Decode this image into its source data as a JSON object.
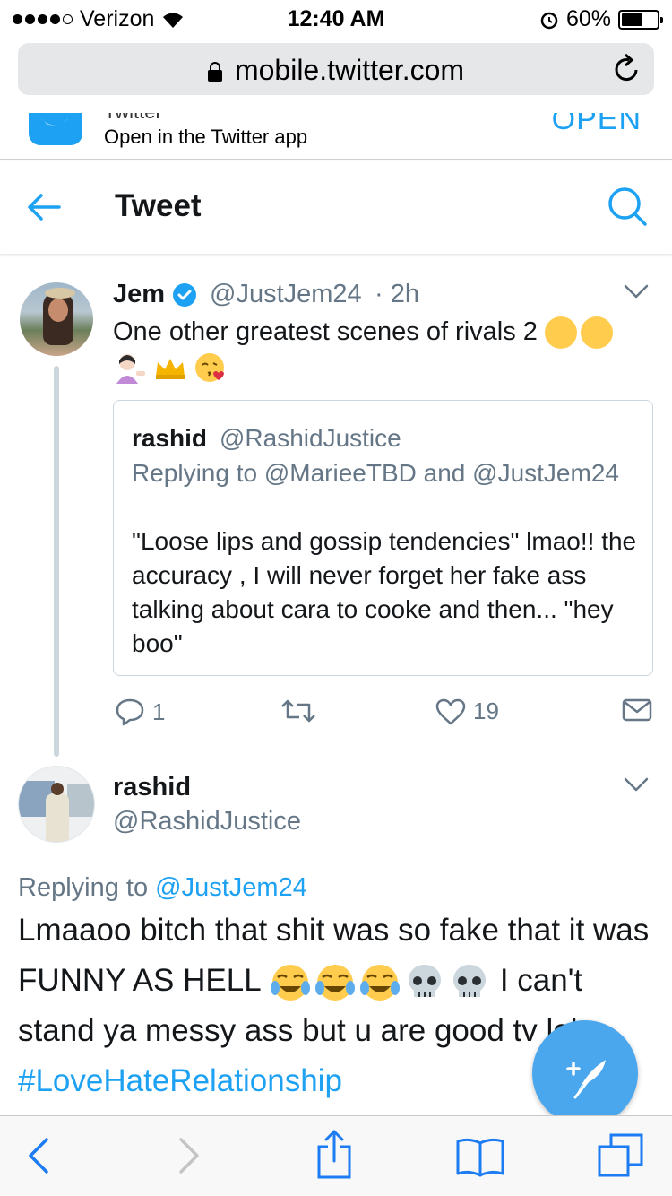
{
  "status_bar": {
    "carrier": "Verizon",
    "time": "12:40 AM",
    "battery_percent": "60%",
    "battery_level": 0.6
  },
  "browser": {
    "url": "mobile.twitter.com"
  },
  "app_banner": {
    "app_name": "Twitter",
    "subtitle": "Open in the Twitter app",
    "open_label": "OPEN"
  },
  "header": {
    "title": "Tweet"
  },
  "tweet1": {
    "name": "Jem",
    "handle": "@JustJem24",
    "time": "· 2h",
    "text": "One other greatest scenes of rivals 2",
    "quoted": {
      "name": "rashid",
      "handle": "@RashidJustice",
      "replying_to": "Replying to @MarieeTBD and @JustJem24",
      "text": "\"Loose lips and gossip tendencies\" lmao!! the accuracy , I will never forget her fake ass talking about cara to cooke and then... \"hey boo\""
    },
    "reply_count": "1",
    "like_count": "19"
  },
  "tweet2": {
    "name": "rashid",
    "handle": "@RashidJustice",
    "replying_label": "Replying to",
    "replying_handle": "@JustJem24",
    "text_part1": "Lmaaoo bitch that shit was so fake that it was FUNNY AS HELL",
    "text_part2": "I can't stand ya messy ass but u are good tv lol",
    "hashtag": "#LoveHateRelationship"
  },
  "colors": {
    "brand_blue": "#1da1f2",
    "text_primary": "#14171a",
    "text_secondary": "#657786"
  },
  "icons": [
    "back-arrow-icon",
    "search-icon",
    "verified-icon",
    "chevron-down-icon",
    "reply-icon",
    "retweet-icon",
    "like-icon",
    "message-icon",
    "compose-icon",
    "safari-back-icon",
    "safari-forward-icon",
    "share-icon",
    "bookmarks-icon",
    "tabs-icon"
  ]
}
